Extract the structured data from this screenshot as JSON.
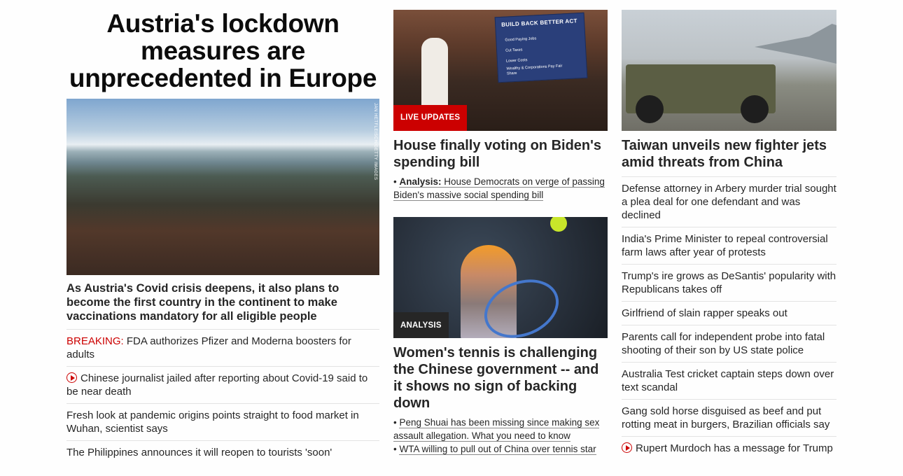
{
  "left": {
    "hero_title": "Austria's lockdown measures are unprecedented in Europe",
    "image_credit": "JAN HETFLEISCH/GETTY IMAGES",
    "hero_caption": "As Austria's Covid crisis deepens, it also plans to become the first country in the continent to make vaccinations mandatory for all eligible people",
    "items": [
      {
        "prefix": "BREAKING:",
        "text": " FDA authorizes Pfizer and Moderna boosters for adults"
      },
      {
        "text": "Chinese journalist jailed after reporting about Covid-19 said to be near death",
        "video": true
      },
      {
        "text": "Fresh look at pandemic origins points straight to food market in Wuhan, scientist says"
      },
      {
        "text": "The Philippines announces it will reopen to tourists 'soon'"
      }
    ]
  },
  "mid": {
    "card1": {
      "tag": "LIVE UPDATES",
      "board_title": "BUILD BACK BETTER ACT",
      "board_lines": [
        "Good Paying Jobs",
        "Cut Taxes",
        "Lower Costs",
        "Wealthy & Corporations Pay Fair Share"
      ],
      "headline": "House finally voting on Biden's spending bill",
      "sub_label": "Analysis:",
      "sub_text": " House Democrats on verge of passing Biden's massive social spending bill"
    },
    "card2": {
      "tag": "ANALYSIS",
      "headline": "Women's tennis is challenging the Chinese government -- and it shows no sign of backing down",
      "links": [
        "Peng Shuai has been missing since making sex assault allegation. What you need to know",
        "WTA willing to pull out of China over tennis star"
      ]
    }
  },
  "right": {
    "headline": "Taiwan unveils new fighter jets amid threats from China",
    "items": [
      {
        "text": "Defense attorney in Arbery murder trial sought a plea deal for one defendant and was declined"
      },
      {
        "text": "India's Prime Minister to repeal controversial farm laws after year of protests"
      },
      {
        "text": "Trump's ire grows as DeSantis' popularity with Republicans takes off"
      },
      {
        "text": "Girlfriend of slain rapper speaks out"
      },
      {
        "text": "Parents call for independent probe into fatal shooting of their son by US state police"
      },
      {
        "text": "Australia Test cricket captain steps down over text scandal"
      },
      {
        "text": "Gang sold horse disguised as beef and put rotting meat in burgers, Brazilian officials say"
      },
      {
        "text": "Rupert Murdoch has a message for Trump",
        "video": true
      }
    ]
  },
  "colors": {
    "accent": "#cc0000",
    "text": "#262626",
    "divider": "#e3e3e3"
  }
}
